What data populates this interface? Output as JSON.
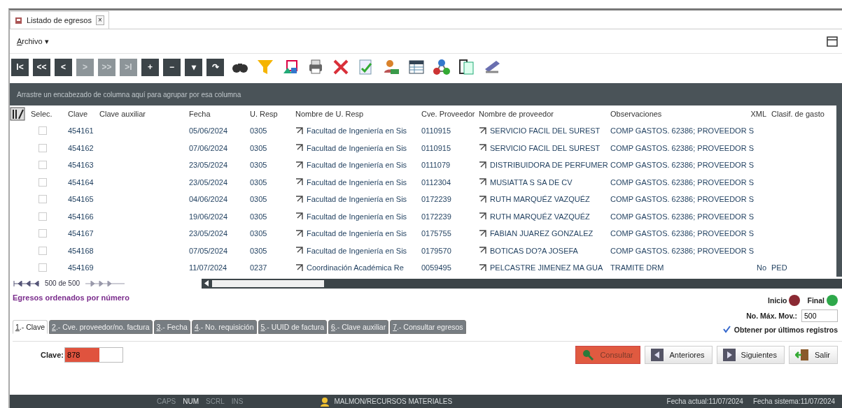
{
  "document_tab": {
    "title": "Listado de egresos",
    "close": "×"
  },
  "menu": {
    "key": "A",
    "label": "rchivo",
    "caret": "▾"
  },
  "nav_buttons": [
    {
      "label": "I<",
      "disabled": false
    },
    {
      "label": "<<",
      "disabled": false
    },
    {
      "label": "<",
      "disabled": false
    },
    {
      "label": ">",
      "disabled": true
    },
    {
      "label": ">>",
      "disabled": true
    },
    {
      "label": ">I",
      "disabled": true
    },
    {
      "label": "+",
      "disabled": false
    },
    {
      "label": "−",
      "disabled": false
    },
    {
      "label": "▾",
      "disabled": false
    },
    {
      "label": "↷",
      "disabled": false
    }
  ],
  "group_panel": {
    "hint": "Arrastre un encabezado de columna aquí para agrupar por esa columna"
  },
  "table": {
    "select_column": "Selec.",
    "columns": [
      "Clave",
      "Clave auxiliar",
      "Fecha",
      "U. Resp",
      "Nombre de U. Resp",
      "Cve. Proveedor",
      "Nombre de proveedor",
      "Observaciones",
      "XML",
      "Clasif. de gasto"
    ],
    "rows": [
      {
        "checked": false,
        "cells": [
          "454161",
          "",
          "05/06/2024",
          "0305",
          "Facultad de Ingeniería en Sis",
          "0110915",
          "SERVICIO FACIL DEL SUREST",
          "COMP GASTOS. 62386; PROVEEDOR S",
          "",
          ""
        ]
      },
      {
        "checked": false,
        "cells": [
          "454162",
          "",
          "07/06/2024",
          "0305",
          "Facultad de Ingeniería en Sis",
          "0110915",
          "SERVICIO FACIL DEL SUREST",
          "COMP GASTOS. 62386; PROVEEDOR S",
          "",
          ""
        ]
      },
      {
        "checked": false,
        "cells": [
          "454163",
          "",
          "23/05/2024",
          "0305",
          "Facultad de Ingeniería en Sis",
          "0111079",
          "DISTRIBUIDORA DE PERFUMER",
          "COMP GASTOS. 62386; PROVEEDOR S",
          "",
          ""
        ]
      },
      {
        "checked": false,
        "cells": [
          "454164",
          "",
          "23/05/2024",
          "0305",
          "Facultad de Ingeniería en Sis",
          "0112304",
          "MUSIATTA S SA DE CV",
          "COMP GASTOS. 62386; PROVEEDOR S",
          "",
          ""
        ]
      },
      {
        "checked": false,
        "cells": [
          "454165",
          "",
          "04/06/2024",
          "0305",
          "Facultad de Ingeniería en Sis",
          "0172239",
          "RUTH MARQUÉZ VAZQUÉZ",
          "COMP GASTOS. 62386; PROVEEDOR S",
          "",
          ""
        ]
      },
      {
        "checked": false,
        "cells": [
          "454166",
          "",
          "19/06/2024",
          "0305",
          "Facultad de Ingeniería en Sis",
          "0172239",
          "RUTH MARQUÉZ VAZQUÉZ",
          "COMP GASTOS. 62386; PROVEEDOR S",
          "",
          ""
        ]
      },
      {
        "checked": false,
        "cells": [
          "454167",
          "",
          "23/05/2024",
          "0305",
          "Facultad de Ingeniería en Sis",
          "0175755",
          "FABIAN JUAREZ GONZALEZ",
          "COMP GASTOS. 62386; PROVEEDOR S",
          "",
          ""
        ]
      },
      {
        "checked": false,
        "cells": [
          "454168",
          "",
          "07/05/2024",
          "0305",
          "Facultad de Ingeniería en Sis",
          "0179570",
          "BOTICAS DO?A JOSEFA",
          "COMP GASTOS. 62386; PROVEEDOR S",
          "",
          ""
        ]
      },
      {
        "checked": false,
        "cells": [
          "454169",
          "",
          "11/07/2024",
          "0237",
          "Coordinación Académica Re",
          "0059495",
          "PELCASTRE JIMENEZ MA GUA",
          "TRAMITE DRM",
          "No",
          "PED"
        ]
      }
    ]
  },
  "pager": {
    "text": "500 de 500"
  },
  "order_label": "Egresos ordenados por número",
  "markers": [
    {
      "label": "Inicio",
      "color": "#8b2a33"
    },
    {
      "label": "Final",
      "color": "#2ea84a"
    }
  ],
  "max_moves": {
    "label": "No. Máx. Mov.:",
    "value": "500"
  },
  "last_records": {
    "label": "Obtener por últimos registros",
    "checked": true
  },
  "search_tabs": [
    {
      "key": "1",
      "label": ".- Clave",
      "selected": true
    },
    {
      "key": "2",
      "label": ".- Cve. proveedor/no. factura",
      "selected": false
    },
    {
      "key": "3",
      "label": ".- Fecha",
      "selected": false
    },
    {
      "key": "4",
      "label": ".- No. requisición",
      "selected": false
    },
    {
      "key": "5",
      "label": ".- UUID de factura",
      "selected": false
    },
    {
      "key": "6",
      "label": ".- Clave auxiliar",
      "selected": false
    },
    {
      "key": "7",
      "label": ".- Consultar egresos",
      "selected": false
    }
  ],
  "clave_field": {
    "label": "Clave:",
    "value": "878",
    "highlighted": true
  },
  "buttons": [
    {
      "label": "Consultar",
      "kind": "search",
      "highlighted": true
    },
    {
      "label": "Anteriores",
      "kind": "previous",
      "highlighted": false
    },
    {
      "label": "Siguientes",
      "kind": "next",
      "highlighted": false
    },
    {
      "label": "Salir",
      "kind": "exit",
      "highlighted": false
    }
  ],
  "status_bar": {
    "keys": [
      {
        "label": "CAPS",
        "on": false
      },
      {
        "label": "NUM",
        "on": true
      },
      {
        "label": "SCRL",
        "on": false
      },
      {
        "label": "INS",
        "on": false
      }
    ],
    "user": "MALMON/RECURSOS MATERIALES",
    "current_date": "Fecha actual:11/07/2024",
    "system_date": "Fecha sistema:11/07/2024"
  }
}
